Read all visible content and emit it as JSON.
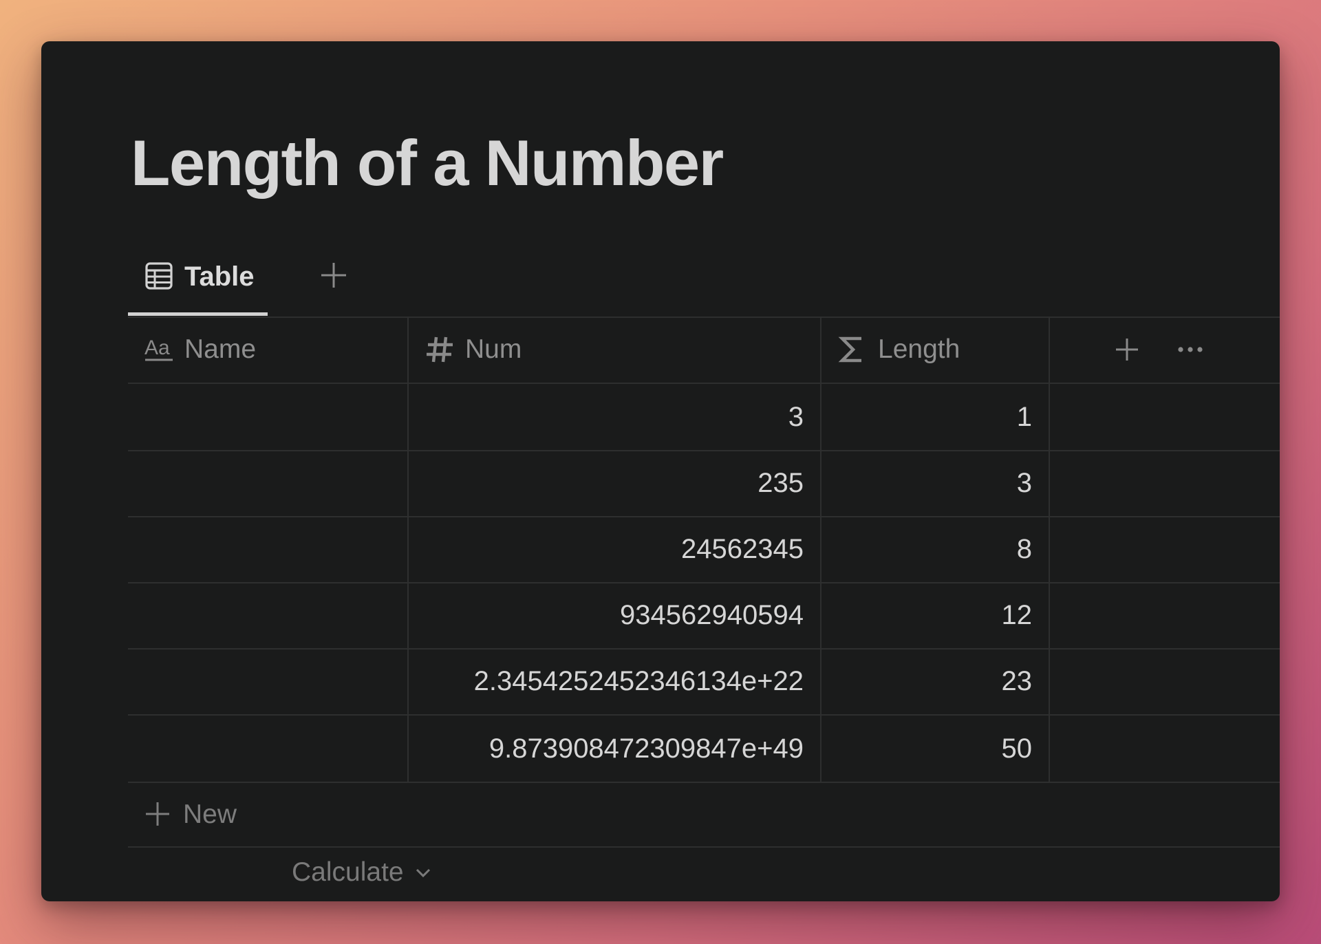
{
  "page": {
    "title": "Length of a Number"
  },
  "views": {
    "tabs": [
      {
        "label": "Table",
        "icon": "table-icon",
        "active": true
      }
    ],
    "add_view_icon": "plus-icon"
  },
  "table": {
    "columns": [
      {
        "label": "Name",
        "icon": "text-type-icon"
      },
      {
        "label": "Num",
        "icon": "hash-icon"
      },
      {
        "label": "Length",
        "icon": "sigma-icon"
      }
    ],
    "header_actions": {
      "add_property_icon": "plus-icon",
      "more_icon": "ellipsis-icon"
    },
    "rows": [
      {
        "name": "",
        "num": "3",
        "length": "1"
      },
      {
        "name": "",
        "num": "235",
        "length": "3"
      },
      {
        "name": "",
        "num": "24562345",
        "length": "8"
      },
      {
        "name": "",
        "num": "934562940594",
        "length": "12"
      },
      {
        "name": "",
        "num": "2.3454252452346134e+22",
        "length": "23"
      },
      {
        "name": "",
        "num": "9.873908472309847e+49",
        "length": "50"
      }
    ],
    "new_row_label": "New",
    "calculate_label": "Calculate"
  },
  "colors": {
    "window_bg": "#1a1b1b",
    "text_primary": "#d6d6d6",
    "text_muted": "#8f8f8f",
    "border": "#2e2f2f"
  }
}
